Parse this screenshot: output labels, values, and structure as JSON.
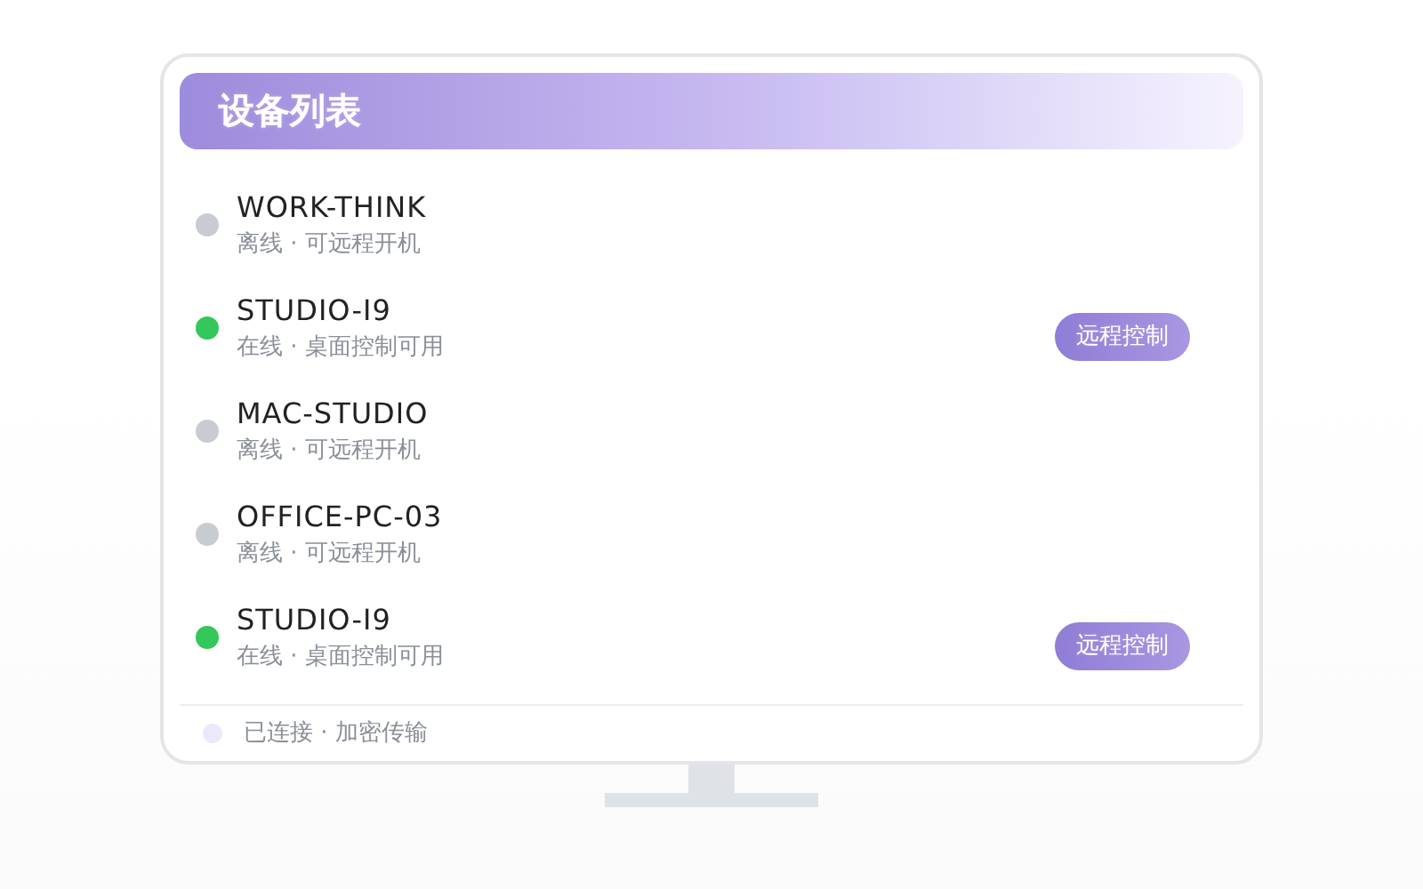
{
  "header": {
    "title": "设备列表"
  },
  "devices": [
    {
      "name": "WORK-THINK",
      "status": "离线 · 可远程开机",
      "online": false
    },
    {
      "name": "STUDIO-I9",
      "status": "在线 · 桌面控制可用",
      "online": true,
      "action": "远程控制"
    },
    {
      "name": "MAC-STUDIO",
      "status": "离线 · 可远程开机",
      "online": false
    },
    {
      "name": "OFFICE-PC-03",
      "status": "离线 · 可远程开机",
      "online": false
    },
    {
      "name": "STUDIO-I9",
      "status": "在线 · 桌面控制可用",
      "online": true,
      "action": "远程控制"
    }
  ],
  "footer": {
    "text": "已连接 · 加密传输"
  }
}
